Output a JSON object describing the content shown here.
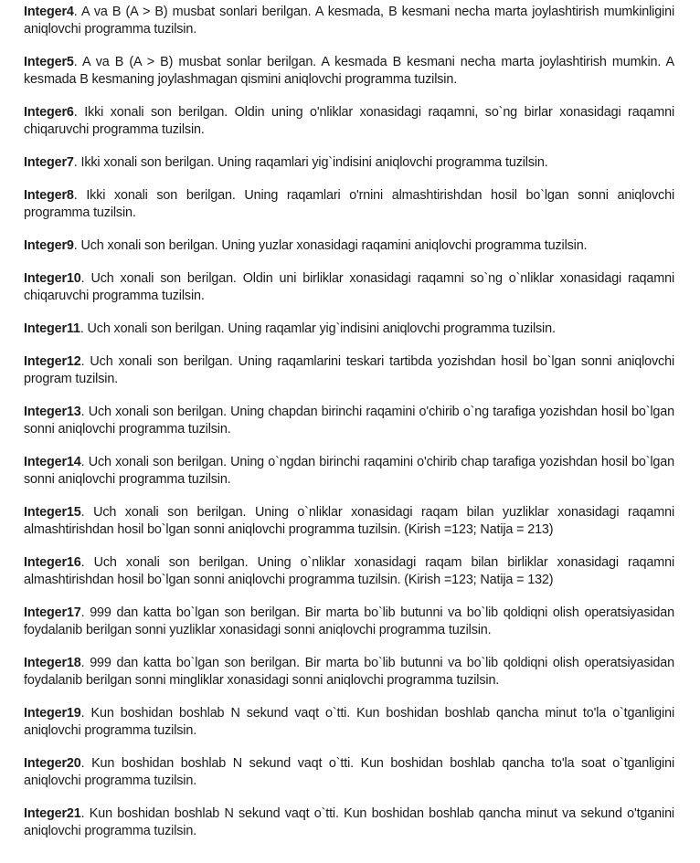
{
  "problems": [
    {
      "id": "Integer4",
      "text": ". A va B (A > B) musbat sonlari berilgan. A kesmada, B kesmani necha marta joylashtirish mumkinligini aniqlovchi programma tuzilsin."
    },
    {
      "id": "Integer5",
      "text": ". A va B (A > B) musbat sonlar berilgan. A kesmada B kesmani necha marta joylashtirish mumkin. A kesmada B kesmaning joylashmagan qismini aniqlovchi programma tuzilsin."
    },
    {
      "id": "Integer6",
      "text": ". Ikki xonali son berilgan. Oldin uning o'nliklar xonasidagi raqamni, so`ng birlar xonasidagi raqamni chiqaruvchi programma tuzilsin."
    },
    {
      "id": "Integer7",
      "text": ". Ikki xonali son berilgan. Uning raqamlari yig`indisini aniqlovchi programma tuzilsin."
    },
    {
      "id": "Integer8",
      "text": ". Ikki xonali son berilgan. Uning raqamlari o'rnini almashtirishdan hosil bo`lgan sonni aniqlovchi programma tuzilsin."
    },
    {
      "id": "Integer9",
      "text": ". Uch xonali son berilgan. Uning yuzlar xonasidagi raqamini aniqlovchi programma tuzilsin."
    },
    {
      "id": "Integer10",
      "text": ". Uch xonali son berilgan. Oldin uni birliklar xonasidagi raqamni so`ng o`nliklar xonasidagi raqamni chiqaruvchi programma tuzilsin."
    },
    {
      "id": "Integer11",
      "text": ". Uch xonali son berilgan. Uning raqamlar yig`indisini aniqlovchi programma tuzilsin."
    },
    {
      "id": "Integer12",
      "text": ". Uch xonali son berilgan. Uning raqamlarini teskari tartibda yozishdan hosil bo`lgan sonni aniqlovchi program tuzilsin."
    },
    {
      "id": "Integer13",
      "text": ". Uch xonali son berilgan. Uning chapdan birinchi raqamini o'chirib o`ng tarafiga yozishdan hosil bo`lgan sonni aniqlovchi programma tuzilsin."
    },
    {
      "id": "Integer14",
      "text": ". Uch xonali son berilgan. Uning o`ngdan birinchi raqamini o'chirib chap tarafiga yozishdan hosil bo`lgan sonni aniqlovchi programma tuzilsin."
    },
    {
      "id": "Integer15",
      "text": ". Uch xonali son berilgan. Uning o`nliklar xonasidagi raqam bilan yuzliklar xonasidagi raqamni almashtirishdan hosil bo`lgan sonni aniqlovchi programma tuzilsin. (Kirish =123;  Natija = 213)"
    },
    {
      "id": "Integer16",
      "text": ". Uch xonali son berilgan. Uning o`nliklar xonasidagi raqam bilan birliklar xonasidagi raqamni almashtirishdan hosil bo`lgan sonni aniqlovchi programma tuzilsin. (Kirish =123; Natija = 132)"
    },
    {
      "id": "Integer17",
      "text": ". 999 dan katta bo`lgan son berilgan. Bir marta bo`lib butunni va bo`lib qoldiqni olish operatsiyasidan foydalanib berilgan sonni yuzliklar xonasidagi sonni aniqlovchi programma tuzilsin."
    },
    {
      "id": "Integer18",
      "text": ". 999 dan katta bo`lgan son berilgan. Bir marta bo`lib butunni va bo`lib qoldiqni olish operatsiyasidan foydalanib berilgan sonni mingliklar xonasidagi sonni aniqlovchi programma tuzilsin."
    },
    {
      "id": "Integer19",
      "text": ". Kun boshidan boshlab N sekund vaqt o`tti. Kun boshidan boshlab qancha minut to'la o`tganligini aniqlovchi programma tuzilsin."
    },
    {
      "id": "Integer20",
      "text": ". Kun boshidan boshlab N sekund vaqt o`tti. Kun boshidan boshlab qancha to'la soat o`tganligini aniqlovchi programma tuzilsin."
    },
    {
      "id": "Integer21",
      "text": ". Kun boshidan boshlab N sekund vaqt o`tti. Kun boshidan boshlab qancha minut va sekund o'tganini aniqlovchi programma tuzilsin."
    }
  ]
}
